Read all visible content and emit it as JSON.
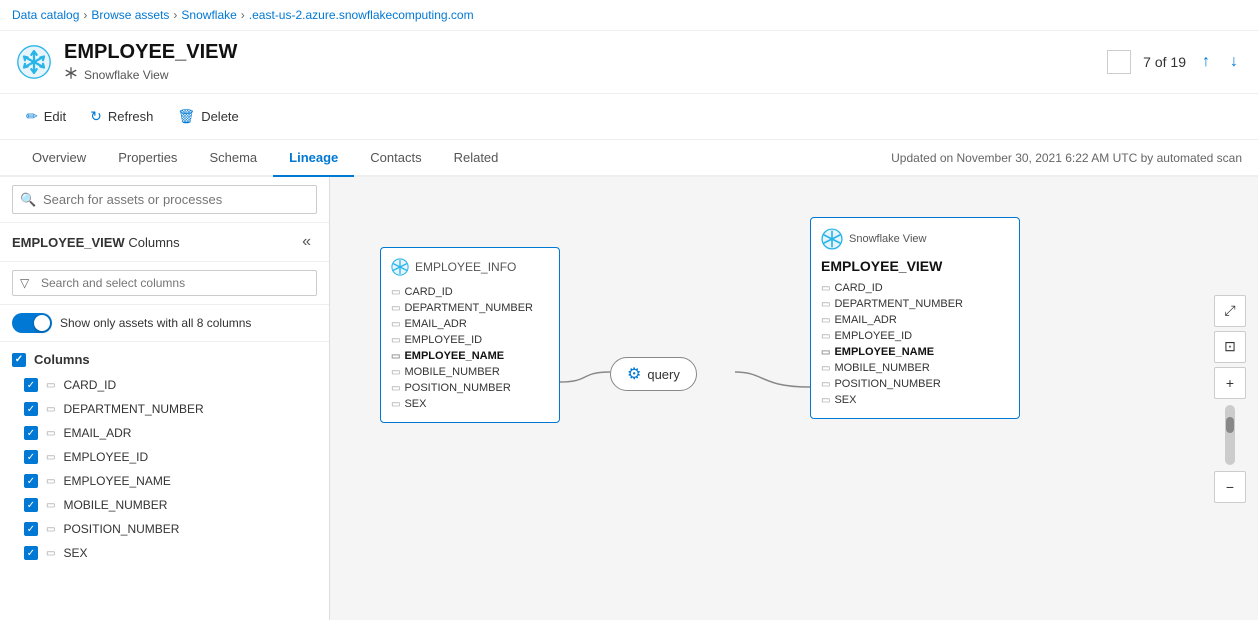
{
  "breadcrumb": {
    "items": [
      "Data catalog",
      "Browse assets",
      "Snowflake",
      ".east-us-2.azure.snowflakecomputing.com"
    ]
  },
  "header": {
    "title": "EMPLOYEE_VIEW",
    "subtitle": "Snowflake View",
    "counter": "7 of 19",
    "logo_alt": "purview-logo"
  },
  "toolbar": {
    "edit_label": "Edit",
    "refresh_label": "Refresh",
    "delete_label": "Delete"
  },
  "tabs": {
    "items": [
      "Overview",
      "Properties",
      "Schema",
      "Lineage",
      "Contacts",
      "Related"
    ],
    "active": "Lineage",
    "updated_text": "Updated on November 30, 2021 6:22 AM UTC by automated scan"
  },
  "left_panel": {
    "search_placeholder": "Search for assets or processes",
    "columns_title": "EMPLOYEE_VIEW",
    "columns_subtitle": "Columns",
    "columns_search_placeholder": "Search and select columns",
    "toggle_label": "Show only assets with all 8 columns",
    "all_columns_label": "Columns",
    "columns": [
      {
        "name": "CARD_ID",
        "checked": true,
        "highlighted": false
      },
      {
        "name": "DEPARTMENT_NUMBER",
        "checked": true,
        "highlighted": false
      },
      {
        "name": "EMAIL_ADR",
        "checked": true,
        "highlighted": false
      },
      {
        "name": "EMPLOYEE_ID",
        "checked": true,
        "highlighted": false
      },
      {
        "name": "EMPLOYEE_NAME",
        "checked": true,
        "highlighted": false
      },
      {
        "name": "MOBILE_NUMBER",
        "checked": true,
        "highlighted": false
      },
      {
        "name": "POSITION_NUMBER",
        "checked": true,
        "highlighted": false
      },
      {
        "name": "SEX",
        "checked": true,
        "highlighted": false
      }
    ]
  },
  "canvas": {
    "source_node": {
      "title": "EMPLOYEE_INFO",
      "fields": [
        "CARD_ID",
        "DEPARTMENT_NUMBER",
        "EMAIL_ADR",
        "EMPLOYEE_ID",
        "EMPLOYEE_NAME",
        "MOBILE_NUMBER",
        "POSITION_NUMBER",
        "SEX"
      ],
      "highlighted_field": "EMPLOYEE_NAME"
    },
    "query_node": {
      "label": "query"
    },
    "target_node": {
      "subtitle": "Snowflake View",
      "title": "EMPLOYEE_VIEW",
      "fields": [
        "CARD_ID",
        "DEPARTMENT_NUMBER",
        "EMAIL_ADR",
        "EMPLOYEE_ID",
        "EMPLOYEE_NAME",
        "MOBILE_NUMBER",
        "POSITION_NUMBER",
        "SEX"
      ],
      "highlighted_field": "EMPLOYEE_NAME"
    }
  },
  "icons": {
    "edit": "✏",
    "refresh": "↻",
    "delete": "🗑",
    "search": "🔍",
    "filter": "⊿",
    "collapse": "«",
    "field": "▭",
    "expand": "⤢",
    "fit": "⊡",
    "zoom_in": "+",
    "zoom_out": "−",
    "nav_up": "↑",
    "nav_down": "↓",
    "check": "✓",
    "caret_right": "›"
  }
}
